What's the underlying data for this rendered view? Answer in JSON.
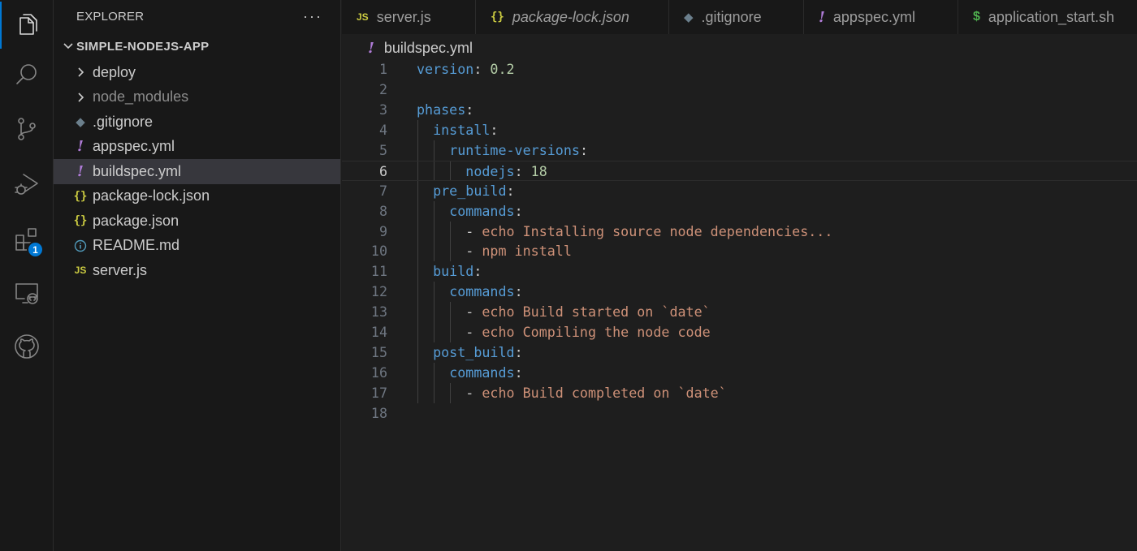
{
  "activity_bar": {
    "items": [
      {
        "name": "explorer"
      },
      {
        "name": "search"
      },
      {
        "name": "source-control"
      },
      {
        "name": "run-and-debug"
      },
      {
        "name": "extensions",
        "badge": "1"
      },
      {
        "name": "remote-explorer"
      },
      {
        "name": "github"
      }
    ]
  },
  "sidebar": {
    "title": "EXPLORER",
    "more": "···",
    "project": "SIMPLE-NODEJS-APP",
    "items": [
      {
        "label": "deploy",
        "icon": "folder-chevron-icon",
        "type": "folder"
      },
      {
        "label": "node_modules",
        "icon": "folder-chevron-icon",
        "type": "folder"
      },
      {
        "label": ".gitignore",
        "icon": "git-icon",
        "type": "git"
      },
      {
        "label": "appspec.yml",
        "icon": "yml-icon",
        "type": "yml"
      },
      {
        "label": "buildspec.yml",
        "icon": "yml-icon",
        "type": "yml"
      },
      {
        "label": "package-lock.json",
        "icon": "json-icon",
        "type": "json"
      },
      {
        "label": "package.json",
        "icon": "json-icon",
        "type": "json"
      },
      {
        "label": "README.md",
        "icon": "info-icon",
        "type": "info"
      },
      {
        "label": "server.js",
        "icon": "js-icon",
        "type": "js"
      }
    ]
  },
  "tabs": [
    {
      "label": "server.js",
      "icon_text": "JS",
      "type": "js"
    },
    {
      "label": "package-lock.json",
      "icon_text": "{}",
      "type": "json"
    },
    {
      "label": ".gitignore",
      "icon_text": "◆",
      "type": "git"
    },
    {
      "label": "appspec.yml",
      "icon_text": "!",
      "type": "yml"
    },
    {
      "label": "application_start.sh",
      "icon_text": "$",
      "type": "sh"
    }
  ],
  "breadcrumb": {
    "icon_text": "!",
    "file": "buildspec.yml"
  },
  "editor": {
    "current_line": 6,
    "lines": [
      {
        "n": "1",
        "tokens": [
          [
            "k",
            "version"
          ],
          [
            "p",
            ": "
          ],
          [
            "n",
            "0.2"
          ]
        ]
      },
      {
        "n": "2",
        "tokens": []
      },
      {
        "n": "3",
        "tokens": [
          [
            "k",
            "phases"
          ],
          [
            "p",
            ":"
          ]
        ]
      },
      {
        "n": "4",
        "tokens": [
          [
            "p",
            "  "
          ],
          [
            "k",
            "install"
          ],
          [
            "p",
            ":"
          ]
        ]
      },
      {
        "n": "5",
        "tokens": [
          [
            "p",
            "    "
          ],
          [
            "k",
            "runtime-versions"
          ],
          [
            "p",
            ":"
          ]
        ]
      },
      {
        "n": "6",
        "tokens": [
          [
            "p",
            "      "
          ],
          [
            "k",
            "nodejs"
          ],
          [
            "p",
            ": "
          ],
          [
            "n",
            "18"
          ]
        ]
      },
      {
        "n": "7",
        "tokens": [
          [
            "p",
            "  "
          ],
          [
            "k",
            "pre_build"
          ],
          [
            "p",
            ":"
          ]
        ]
      },
      {
        "n": "8",
        "tokens": [
          [
            "p",
            "    "
          ],
          [
            "k",
            "commands"
          ],
          [
            "p",
            ":"
          ]
        ]
      },
      {
        "n": "9",
        "tokens": [
          [
            "p",
            "      - "
          ],
          [
            "s",
            "echo Installing source node dependencies..."
          ]
        ]
      },
      {
        "n": "10",
        "tokens": [
          [
            "p",
            "      - "
          ],
          [
            "s",
            "npm install"
          ]
        ]
      },
      {
        "n": "11",
        "tokens": [
          [
            "p",
            "  "
          ],
          [
            "k",
            "build"
          ],
          [
            "p",
            ":"
          ]
        ]
      },
      {
        "n": "12",
        "tokens": [
          [
            "p",
            "    "
          ],
          [
            "k",
            "commands"
          ],
          [
            "p",
            ":"
          ]
        ]
      },
      {
        "n": "13",
        "tokens": [
          [
            "p",
            "      - "
          ],
          [
            "s",
            "echo Build started on `date`"
          ]
        ]
      },
      {
        "n": "14",
        "tokens": [
          [
            "p",
            "      - "
          ],
          [
            "s",
            "echo Compiling the node code"
          ]
        ]
      },
      {
        "n": "15",
        "tokens": [
          [
            "p",
            "  "
          ],
          [
            "k",
            "post_build"
          ],
          [
            "p",
            ":"
          ]
        ]
      },
      {
        "n": "16",
        "tokens": [
          [
            "p",
            "    "
          ],
          [
            "k",
            "commands"
          ],
          [
            "p",
            ":"
          ]
        ]
      },
      {
        "n": "17",
        "tokens": [
          [
            "p",
            "      - "
          ],
          [
            "s",
            "echo Build completed on `date`"
          ]
        ]
      },
      {
        "n": "18",
        "tokens": []
      }
    ]
  },
  "colors": {
    "accent": "#0078d4",
    "yaml_key": "#569cd6",
    "yaml_string": "#ce9178",
    "yaml_number": "#b5cea8"
  }
}
